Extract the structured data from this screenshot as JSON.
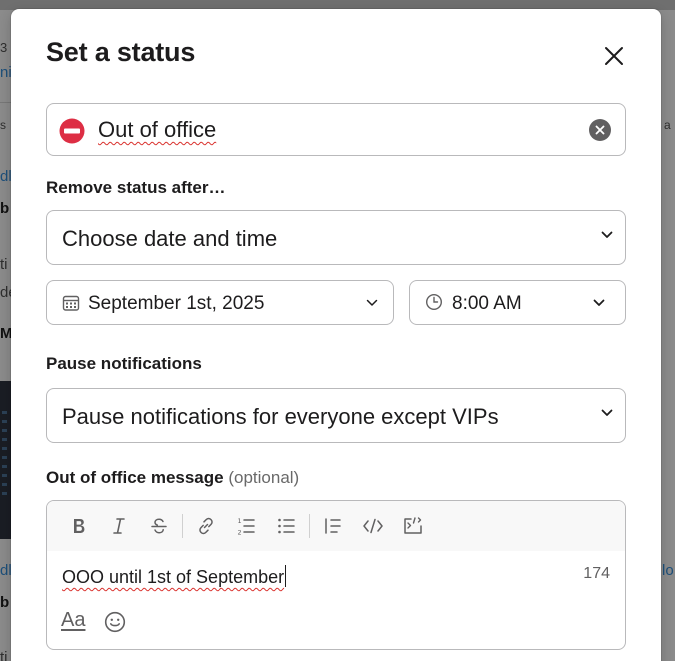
{
  "background": {
    "fragments": [
      "3",
      "ni",
      "s",
      "a",
      "dl",
      "b",
      "ti",
      "de",
      "Mu",
      "dl",
      "lo",
      "b",
      "ti"
    ]
  },
  "modal": {
    "title": "Set a status",
    "status": {
      "emoji": "no-entry-icon",
      "text": "Out of office"
    },
    "remove_after": {
      "label": "Remove status after…",
      "selected": "Choose date and time",
      "date": "September 1st, 2025",
      "time": "8:00 AM"
    },
    "pause": {
      "label": "Pause notifications",
      "selected": "Pause notifications for everyone except VIPs"
    },
    "ooo_message": {
      "label": "Out of office message",
      "optional": "(optional)",
      "text": "OOO until 1st of September",
      "char_count": "174",
      "toolbar": [
        "bold-icon",
        "italic-icon",
        "strikethrough-icon",
        "link-icon",
        "ordered-list-icon",
        "bulleted-list-icon",
        "blockquote-icon",
        "code-icon",
        "code-block-icon"
      ],
      "format_label": "Aa"
    },
    "colors": {
      "emoji_red": "#dd2e44",
      "text": "#1d1c1d",
      "muted": "#616061",
      "border": "#b9b9bb"
    }
  }
}
